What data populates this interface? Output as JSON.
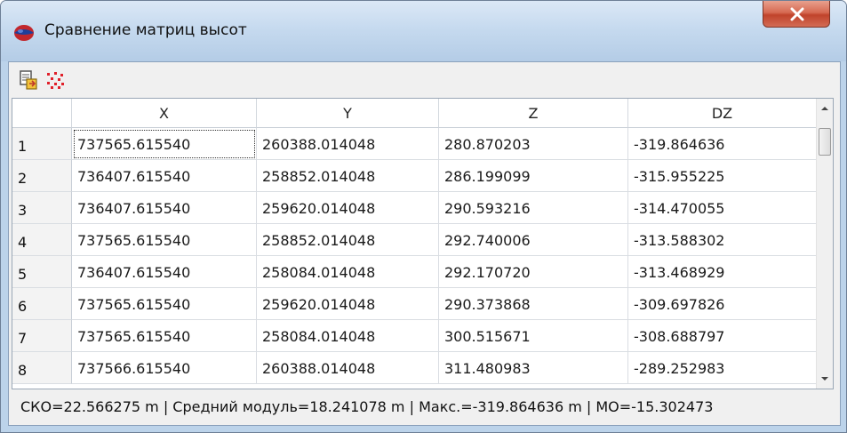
{
  "window": {
    "title": "Сравнение матриц высот"
  },
  "toolbar": {
    "buttons": [
      {
        "icon": "copy-to-clipboard-icon"
      },
      {
        "icon": "points-scatter-icon"
      }
    ]
  },
  "table": {
    "columns": [
      "X",
      "Y",
      "Z",
      "DZ"
    ],
    "rows": [
      {
        "num": "1",
        "x": "737565.615540",
        "y": "260388.014048",
        "z": "280.870203",
        "dz": "-319.864636"
      },
      {
        "num": "2",
        "x": "736407.615540",
        "y": "258852.014048",
        "z": "286.199099",
        "dz": "-315.955225"
      },
      {
        "num": "3",
        "x": "736407.615540",
        "y": "259620.014048",
        "z": "290.593216",
        "dz": "-314.470055"
      },
      {
        "num": "4",
        "x": "737565.615540",
        "y": "258852.014048",
        "z": "292.740006",
        "dz": "-313.588302"
      },
      {
        "num": "5",
        "x": "736407.615540",
        "y": "258084.014048",
        "z": "292.170720",
        "dz": "-313.468929"
      },
      {
        "num": "6",
        "x": "737565.615540",
        "y": "259620.014048",
        "z": "290.373868",
        "dz": "-309.697826"
      },
      {
        "num": "7",
        "x": "737565.615540",
        "y": "258084.014048",
        "z": "300.515671",
        "dz": "-308.688797"
      },
      {
        "num": "8",
        "x": "737566.615540",
        "y": "260388.014048",
        "z": "311.480983",
        "dz": "-289.252983"
      }
    ]
  },
  "status": {
    "text": "СКО=22.566275 m | Средний модуль=18.241078 m | Макс.=-319.864636 m | МО=-15.302473"
  },
  "colors": {
    "titlebar": "#c6daef",
    "close_button": "#c0432b",
    "scatter_icon": "#e0202a"
  }
}
